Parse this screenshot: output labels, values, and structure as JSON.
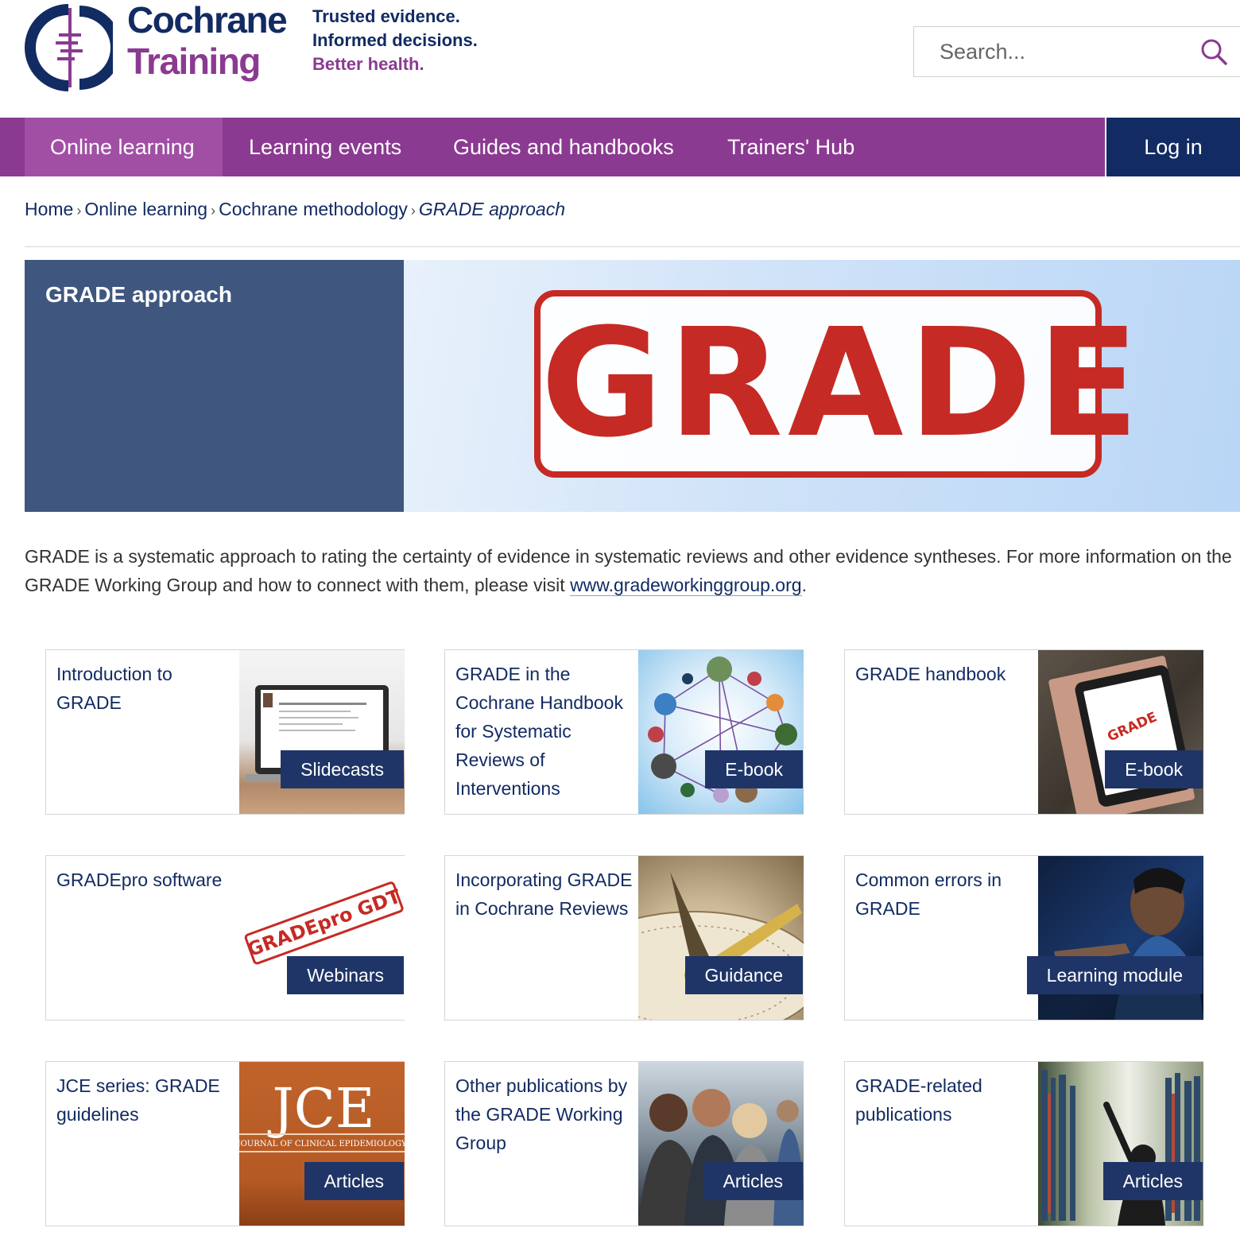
{
  "brand": {
    "line1": "Cochrane",
    "line2": "Training",
    "colors": {
      "navy": "#122b63",
      "purple": "#8b3a91",
      "active_purple": "#a14fa5",
      "red": "#c62a24"
    }
  },
  "tagline": {
    "line1": "Trusted evidence.",
    "line2": "Informed decisions.",
    "line3": "Better health."
  },
  "search": {
    "placeholder": "Search...",
    "icon": "search-icon"
  },
  "nav": {
    "items": [
      {
        "label": "Online learning",
        "active": true
      },
      {
        "label": "Learning events",
        "active": false
      },
      {
        "label": "Guides and handbooks",
        "active": false
      },
      {
        "label": "Trainers' Hub",
        "active": false
      }
    ],
    "login": "Log in"
  },
  "breadcrumb": {
    "items": [
      "Home",
      "Online learning",
      "Cochrane methodology"
    ],
    "current": "GRADE approach",
    "separator": "›"
  },
  "banner": {
    "title": "GRADE approach",
    "image_text": "GRADE"
  },
  "intro": {
    "text": "GRADE is a systematic approach to rating the certainty of evidence in systematic reviews and other evidence syntheses. For more information on the GRADE Working Group and how to connect with them, please visit ",
    "link": "www.gradeworkinggroup.org",
    "suffix": "."
  },
  "cards": [
    {
      "title": "Introduction to GRADE",
      "label": "Slidecasts",
      "thumb": "laptop-slides-image"
    },
    {
      "title": "GRADE in the Cochrane Handbook for Systematic Reviews of Interventions",
      "label": "E-book",
      "thumb": "network-globe-image"
    },
    {
      "title": "GRADE handbook",
      "label": "E-book",
      "thumb": "tablet-grade-image",
      "image_text": "GRADE"
    },
    {
      "title": "GRADEpro software",
      "label": "Webinars",
      "thumb": "gradepro-stamp-image",
      "image_text": "GRADEpro GDT"
    },
    {
      "title": "Incorporating GRADE in Cochrane Reviews",
      "label": "Guidance",
      "thumb": "compass-image"
    },
    {
      "title": "Common errors in GRADE",
      "label": "Learning module",
      "thumb": "student-screen-image"
    },
    {
      "title": "JCE series: GRADE guidelines",
      "label": "Articles",
      "thumb": "jce-cover-image",
      "image_text": "JCE",
      "image_subtext": "JOURNAL OF CLINICAL EPIDEMIOLOGY"
    },
    {
      "title": "Other publications by the GRADE Working Group",
      "label": "Articles",
      "thumb": "people-meeting-image"
    },
    {
      "title": "GRADE-related publications",
      "label": "Articles",
      "thumb": "library-image"
    }
  ]
}
